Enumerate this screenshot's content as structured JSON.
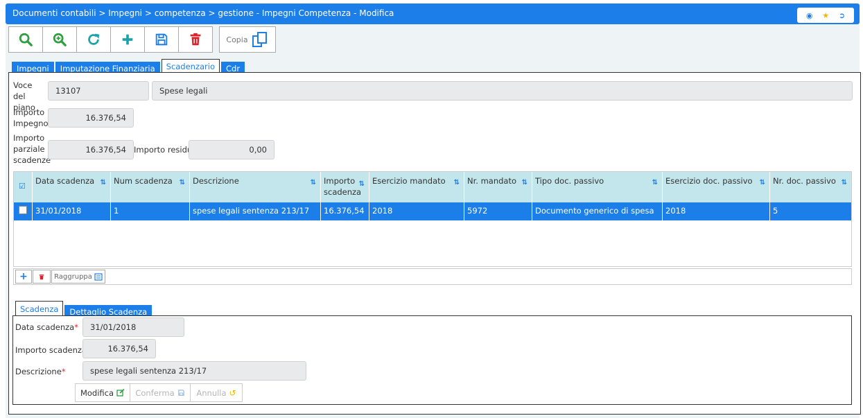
{
  "title": "Documenti contabili > Impegni > competenza > gestione - Impegni Competenza - Modifica",
  "header_icons": [
    "info-icon",
    "star-icon",
    "logout-icon"
  ],
  "toolbar": {
    "buttons": [
      "search-icon",
      "zoom-in-icon",
      "refresh-icon",
      "add-icon",
      "save-icon",
      "delete-icon"
    ],
    "copia_label": "Copia"
  },
  "tabs": [
    "Impegni",
    "Imputazione Finanziaria",
    "Scadenzario",
    "Cdr"
  ],
  "active_tab": "Scadenzario",
  "form": {
    "voce_label": "Voce del piano",
    "voce_code": "13107",
    "voce_desc": "Spese legali",
    "importo_impegno_label": "Importo Impegno",
    "importo_impegno": "16.376,54",
    "importo_parziale_label": "Importo parziale scadenze",
    "importo_parziale": "16.376,54",
    "importo_residuo_label": "Importo residuo",
    "importo_residuo": "0,00"
  },
  "grid": {
    "columns": [
      "Data scadenza",
      "Num scadenza",
      "Descrizione",
      "Importo scadenza",
      "Esercizio mandato",
      "Nr. mandato",
      "Tipo doc. passivo",
      "Esercizio doc. passivo",
      "Nr. doc. passivo"
    ],
    "rows": [
      [
        "31/01/2018",
        "1",
        "spese legali sentenza 213/17",
        "16.376,54",
        "2018",
        "5972",
        "Documento generico di spesa",
        "2018",
        "5"
      ]
    ],
    "raggruppa_label": "Raggruppa"
  },
  "detail_tabs": [
    "Scadenza",
    "Dettaglio Scadenza"
  ],
  "detail": {
    "data_label": "Data scadenza",
    "data_value": "31/01/2018",
    "importo_label": "Importo scadenza",
    "importo_value": "16.376,54",
    "descrizione_label": "Descrizione",
    "descrizione_value": "spese legali sentenza 213/17",
    "required_mark": "*",
    "modifica_label": "Modifica",
    "conferma_label": "Conferma",
    "annulla_label": "Annulla"
  },
  "colors": {
    "accent": "#1c7ee8",
    "grid_header": "#c3e5ec",
    "danger": "#d9232d",
    "success": "#2e9e3e"
  }
}
